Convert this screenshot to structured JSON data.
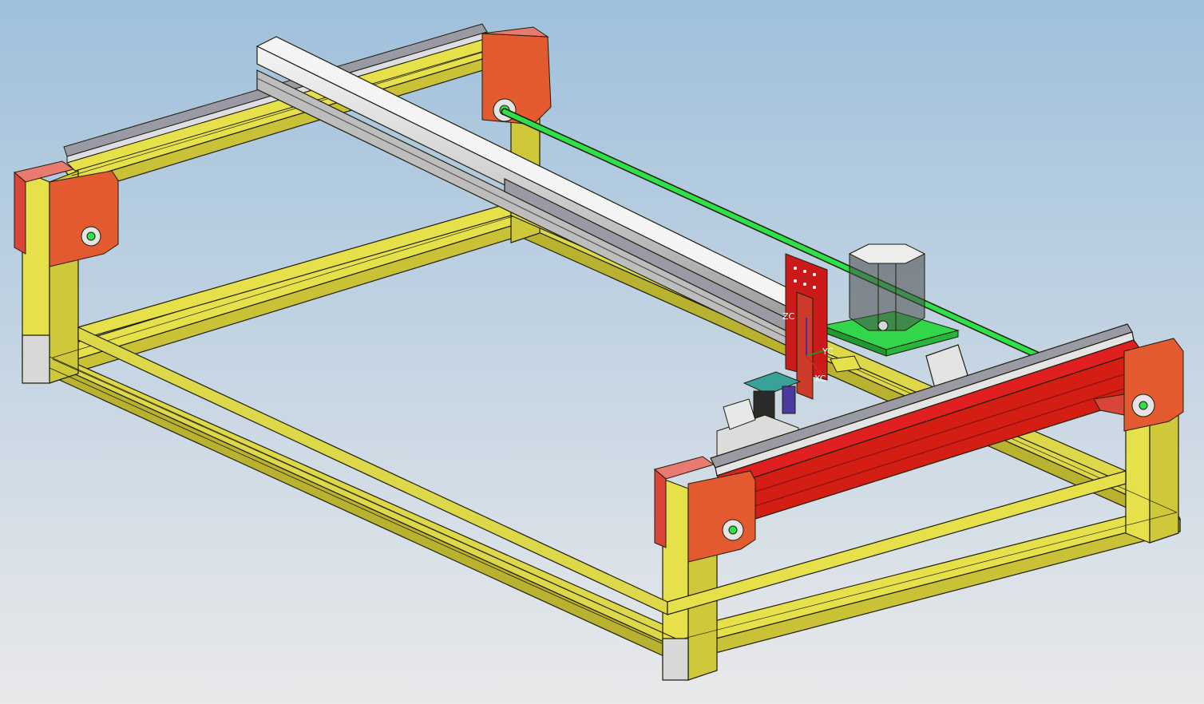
{
  "triad": {
    "z_label": "ZC",
    "y_label": "YC",
    "x_label": "XC"
  },
  "colors": {
    "background_top": "#9fc0dc",
    "background_bottom": "#e9e9ea",
    "frame_profile": "#e6e04a",
    "frame_edge": "#1e1e0a",
    "y_axis_profile_front": "#d41e14",
    "corner_plate": "#e0453a",
    "gantry_beam": "#dcdcdc",
    "linear_rail": "#9a9aa4",
    "drive_shaft": "#2ee04a",
    "motor_mount_plate": "#32d64a",
    "axis_x": "#e02020",
    "axis_y": "#20a020",
    "axis_z": "#2020e0"
  },
  "parts": [
    "frame",
    "gantry-beam",
    "drive-shaft",
    "y-axis-rail-front",
    "y-axis-rail-back",
    "corner-plates",
    "stepper-motor",
    "tool-carriage",
    "coordinate-triad"
  ]
}
